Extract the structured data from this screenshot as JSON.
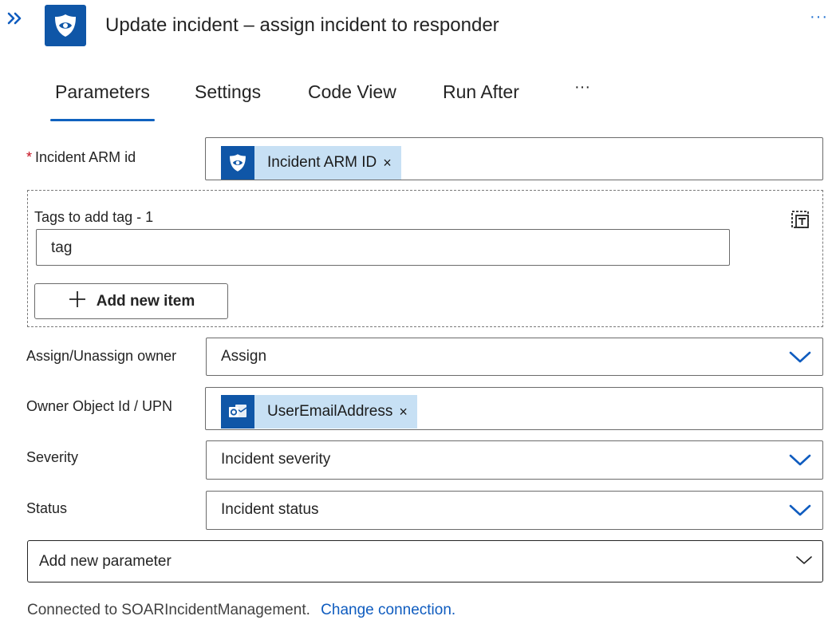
{
  "header": {
    "expand_icon": "double-chevron-right-icon",
    "app_icon": "sentinel-shield-icon",
    "title": "Update incident – assign incident to responder",
    "more_label": "···"
  },
  "tabs": [
    {
      "label": "Parameters",
      "selected": true
    },
    {
      "label": "Settings",
      "selected": false
    },
    {
      "label": "Code View",
      "selected": false
    },
    {
      "label": "Run After",
      "selected": false
    }
  ],
  "tabs_more_label": "···",
  "fields": {
    "incident_arm_id": {
      "required_marker": "*",
      "label": "Incident ARM id",
      "token_text": "Incident ARM ID",
      "token_icon": "sentinel-shield-icon",
      "remove_label": "×"
    },
    "tags": {
      "label": "Tags to add tag - 1",
      "value": "tag",
      "mode_icon": "text-mode-icon",
      "add_item_label": "Add new item"
    },
    "assign_owner": {
      "label": "Assign/Unassign owner",
      "value": "Assign"
    },
    "owner_id": {
      "label": "Owner Object Id / UPN",
      "token_text": "UserEmailAddress",
      "token_icon": "outlook-icon",
      "remove_label": "×"
    },
    "severity": {
      "label": "Severity",
      "value": "Incident severity"
    },
    "status": {
      "label": "Status",
      "value": "Incident status"
    },
    "add_parameter": {
      "value": "Add new parameter"
    }
  },
  "footer": {
    "connected_text": "Connected to SOARIncidentManagement.",
    "change_link": "Change connection."
  },
  "colors": {
    "accent": "#0f5cbf",
    "token_bg": "#c7e0f4",
    "icon_bg": "#0f56a7",
    "required": "#c50f1f"
  }
}
